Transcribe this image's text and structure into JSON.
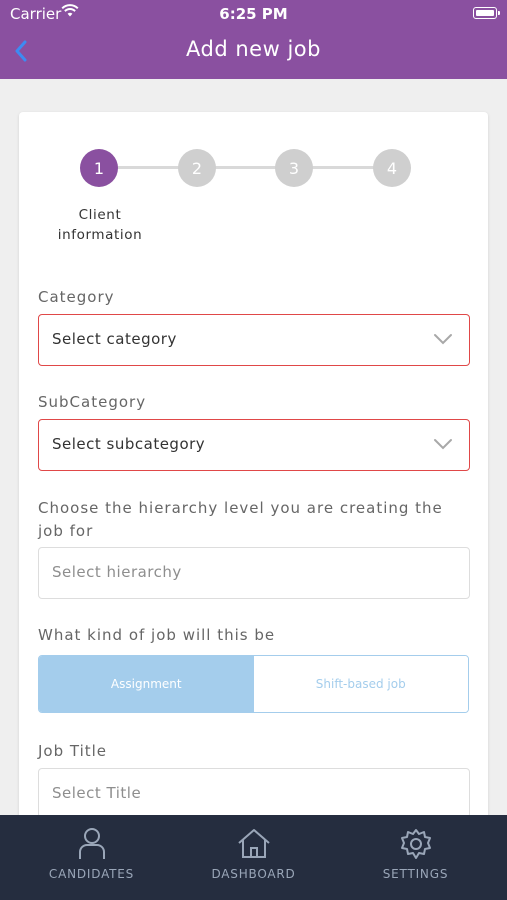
{
  "status_bar": {
    "carrier": "Carrier",
    "time": "6:25 PM"
  },
  "header": {
    "title": "Add new job",
    "back_icon": "chevron-left-icon"
  },
  "stepper": {
    "steps": [
      "1",
      "2",
      "3",
      "4"
    ],
    "active_step": 1,
    "active_label_line1": "Client",
    "active_label_line2": "information"
  },
  "form": {
    "category": {
      "label": "Category",
      "value": "Select category"
    },
    "subcategory": {
      "label": "SubCategory",
      "value": "Select subcategory"
    },
    "hierarchy": {
      "label": "Choose the hierarchy level you are creating the job for",
      "placeholder": "Select hierarchy"
    },
    "job_kind": {
      "label": "What kind of job will this be",
      "options": [
        "Assignment",
        "Shift-based job"
      ],
      "selected": "Assignment"
    },
    "job_title": {
      "label": "Job Title",
      "placeholder": "Select Title"
    }
  },
  "tabbar": {
    "items": [
      {
        "label": "CANDIDATES",
        "icon": "person-icon"
      },
      {
        "label": "DASHBOARD",
        "icon": "home-icon"
      },
      {
        "label": "SETTINGS",
        "icon": "gear-icon"
      }
    ]
  },
  "colors": {
    "header": "#8a50a0",
    "error_border": "#e04848",
    "segment_active": "#a4cdec",
    "tabbar": "#252d3f"
  }
}
